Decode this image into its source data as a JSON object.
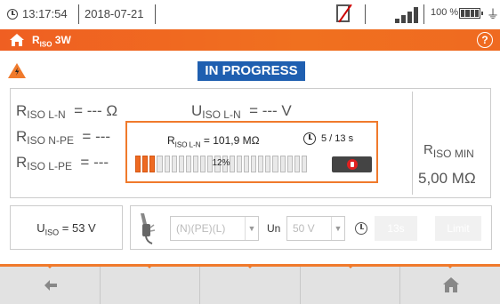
{
  "status_bar": {
    "time": "13:17:54",
    "date": "2018-07-21",
    "battery_percent": "100 %",
    "signal_bars": 4
  },
  "header": {
    "title": "R",
    "title_sub": "ISO",
    "title_suffix": " 3W",
    "help": "?"
  },
  "status": {
    "badge": "IN PROGRESS"
  },
  "measurements": {
    "r_ln": {
      "symbol": "R",
      "sub": "ISO L-N",
      "value": "= --- Ω"
    },
    "u_ln": {
      "symbol": "U",
      "sub": "ISO L-N",
      "value": "= --- V"
    },
    "r_npe": {
      "symbol": "R",
      "sub": "ISO N-PE",
      "value": "= ---"
    },
    "r_lpe": {
      "symbol": "R",
      "sub": "ISO L-PE",
      "value": "= ---"
    },
    "r_min": {
      "symbol": "R",
      "sub": "ISO MIN",
      "value": "5,00 MΩ"
    }
  },
  "progress_popup": {
    "res_symbol": "R",
    "res_sub": "ISO L-N",
    "res_value": " = 101,9 MΩ",
    "time": "5 / 13 s",
    "percent_text": "12%",
    "progress": 0.12,
    "segments": 24
  },
  "settings": {
    "u_iso_symbol": "U",
    "u_iso_sub": "ISO",
    "u_iso_value": " = 53 V",
    "config_select": "(N)(PE)(L)",
    "un_label": "Un",
    "un_select": "50 V",
    "time_button": "13s",
    "limit_button": "Limit"
  },
  "colors": {
    "accent": "#f07a2c",
    "badge": "#1f5fb0",
    "stop": "#e02020"
  },
  "icons": {
    "back": "arrow-left-icon",
    "home": "home-icon"
  }
}
